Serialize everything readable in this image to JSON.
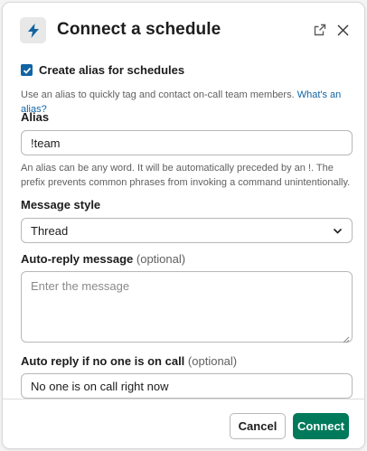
{
  "header": {
    "title": "Connect a schedule",
    "app_icon": "lightning-bolt-icon",
    "external_icon": "open-external-icon",
    "close_icon": "close-icon"
  },
  "alias_toggle": {
    "label": "Create alias for schedules",
    "checked": true,
    "hint": "Use an alias to quickly tag and contact on-call team members.",
    "hint_link": "What's an alias?"
  },
  "alias": {
    "label": "Alias",
    "value": "!team",
    "hint": "An alias can be any word. It will be automatically preceded by an !. The prefix prevents common phrases from invoking a command unintentionally."
  },
  "message_style": {
    "label": "Message style",
    "value": "Thread"
  },
  "auto_reply": {
    "label": "Auto-reply message",
    "optional": "(optional)",
    "placeholder": "Enter the message"
  },
  "auto_reply_no_oncall": {
    "label": "Auto reply if no one is on call",
    "optional": "(optional)",
    "value": "No one is on call right now"
  },
  "footer": {
    "cancel_label": "Cancel",
    "connect_label": "Connect"
  },
  "colors": {
    "accent_blue": "#1264a3",
    "connect_green": "#007a5a"
  }
}
